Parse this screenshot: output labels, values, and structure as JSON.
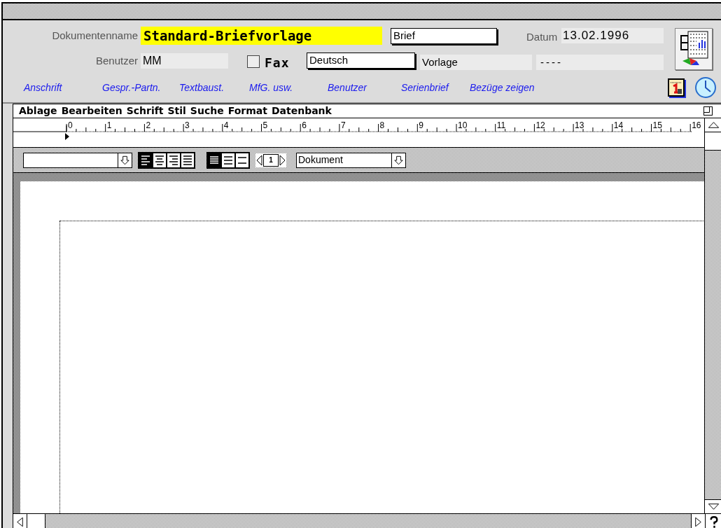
{
  "document_name": {
    "label": "Dokumentenname",
    "value": "Standard-Briefvorlage"
  },
  "type_field": {
    "value": "Brief"
  },
  "date": {
    "label": "Datum",
    "value": "13.02.1996"
  },
  "user": {
    "label": "Benutzer",
    "value": "MM"
  },
  "fax": {
    "label": "Fax",
    "checked": false
  },
  "language_field": {
    "value": "Deutsch"
  },
  "template_field": {
    "value": "Vorlage"
  },
  "field_5": {
    "value": "----"
  },
  "links": [
    "Anschrift",
    "Gespr.-Partn.",
    "Textbaust.",
    "MfG. usw.",
    "Benutzer",
    "Serienbrief",
    "Bezüge zeigen"
  ],
  "menu": [
    "Ablage",
    "Bearbeiten",
    "Schrift",
    "Stil",
    "Suche",
    "Format",
    "Datenbank"
  ],
  "ruler": {
    "labels": [
      "0",
      "1",
      "2",
      "3",
      "4",
      "5",
      "6",
      "7",
      "8",
      "9",
      "10",
      "11",
      "12",
      "13",
      "14",
      "15",
      "16"
    ]
  },
  "toolbar": {
    "alignment": [
      {
        "kind": "left",
        "selected": true
      },
      {
        "kind": "center",
        "selected": false
      },
      {
        "kind": "right",
        "selected": false
      },
      {
        "kind": "justify",
        "selected": false
      }
    ],
    "spacing": [
      {
        "kind": "single",
        "selected": true
      },
      {
        "kind": "double",
        "selected": false
      },
      {
        "kind": "triple",
        "selected": false
      }
    ],
    "page": "1",
    "view_dropdown": "Dokument"
  }
}
